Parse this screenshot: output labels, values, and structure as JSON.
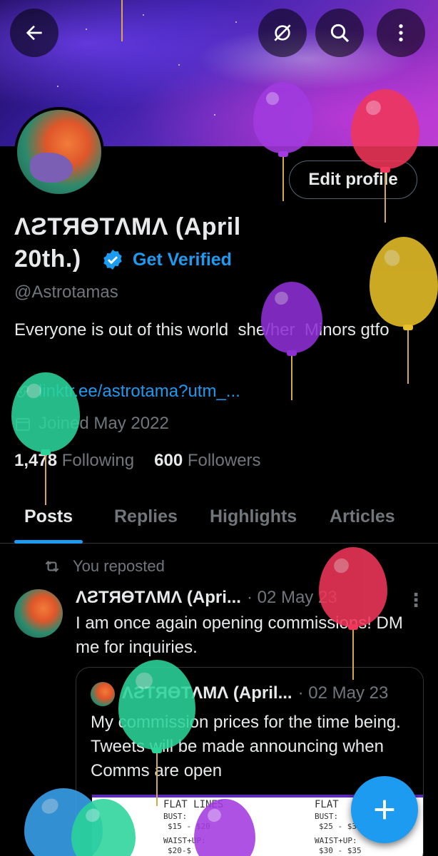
{
  "header": {
    "back_icon": "arrow-left-icon",
    "grok_icon": "grok-icon",
    "search_icon": "search-icon",
    "more_icon": "more-vertical-icon"
  },
  "profile": {
    "edit_label": "Edit profile",
    "name": "ΛƧTЯӨTΛMΛ (April 20th.)",
    "get_verified": "Get Verified",
    "handle": "@Astrotamas",
    "bio": "Everyone is out of this world  she/her  Minors gtfo",
    "link": "linktr.ee/astrotama?utm_...",
    "joined": "Joined May 2022",
    "following_count": "1,478",
    "following_label": "Following",
    "followers_count": "600",
    "followers_label": "Followers"
  },
  "tabs": [
    {
      "label": "Posts"
    },
    {
      "label": "Replies"
    },
    {
      "label": "Highlights"
    },
    {
      "label": "Articles"
    }
  ],
  "post": {
    "repost_label": "You reposted",
    "author": "ΛƧTЯӨTΛMΛ (Apri...",
    "date": "· 02 May 23",
    "more": "⋮",
    "text": "I am once again opening commissions! DM me for inquiries.",
    "quote": {
      "author": "ΛƧTЯӨTΛMΛ (April...",
      "date": "· 02 May 23",
      "text": "My commission prices for the time being. Tweets will be made announcing when Comms are open",
      "media": {
        "title1": "FLAT LINES",
        "bust1": "BUST:",
        "bust1_price": "$15 - $20",
        "waist1": "WAIST+UP:",
        "waist1_price": "$20-$",
        "title2": "FLAT",
        "bust2": "BUST:",
        "bust2_price": "$25 - $30",
        "waist2": "WAIST+UP:",
        "waist2_price": "$30 - $35"
      }
    }
  },
  "fab": {
    "icon": "plus-icon"
  },
  "colors": {
    "accent": "#1d9bf0",
    "background": "#000000",
    "muted": "#71767b"
  }
}
